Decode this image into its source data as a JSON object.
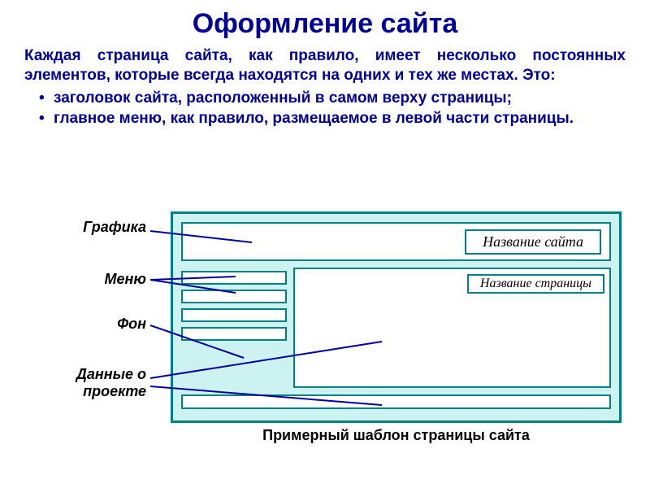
{
  "title": "Оформление сайта",
  "intro": "Каждая страница сайта, как правило, имеет несколько постоянных элементов, которые всегда находятся на одних и тех же местах. Это:",
  "bullets": [
    "заголовок сайта, расположенный в самом верху страницы;",
    "главное меню, как правило, размещаемое в левой части страницы."
  ],
  "labels": {
    "graphics": "Графика",
    "menu": "Меню",
    "background": "Фон",
    "project_data": "Данные о проекте"
  },
  "template": {
    "site_title": "Название сайта",
    "page_title": "Название страницы"
  },
  "caption": "Примерный шаблон страницы сайта"
}
